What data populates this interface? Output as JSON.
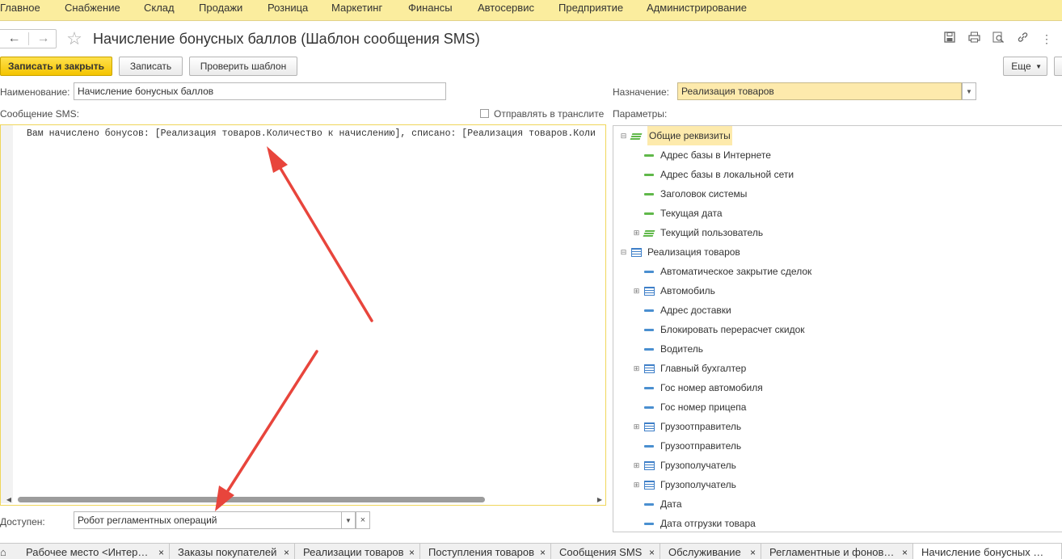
{
  "menu": [
    "Главное",
    "Снабжение",
    "Склад",
    "Продажи",
    "Розница",
    "Маркетинг",
    "Финансы",
    "Автосервис",
    "Предприятие",
    "Администрирование"
  ],
  "window": {
    "title": "Начисление бонусных баллов (Шаблон сообщения SMS)"
  },
  "toolbar": {
    "save_close": "Записать и закрыть",
    "save": "Записать",
    "check": "Проверить шаблон",
    "more": "Еще"
  },
  "form": {
    "name_label": "Наименование:",
    "name_value": "Начисление бонусных баллов",
    "purpose_label": "Назначение:",
    "purpose_value": "Реализация товаров",
    "sms_label": "Сообщение SMS:",
    "translit_label": "Отправлять в транслите",
    "params_label": "Параметры:",
    "sms_text": "Вам начислено бонусов: [Реализация товаров.Количество к начислению], списано: [Реализация товаров.Коли",
    "available_label": "Доступен:",
    "available_value": "Робот регламентных операций"
  },
  "tree": [
    {
      "label": "Общие реквизиты",
      "level": 0,
      "icon": "stack-green",
      "expander": "minus",
      "selected": true
    },
    {
      "label": "Адрес базы в Интернете",
      "level": 1,
      "icon": "dash-green",
      "expander": ""
    },
    {
      "label": "Адрес базы в локальной сети",
      "level": 1,
      "icon": "dash-green",
      "expander": ""
    },
    {
      "label": "Заголовок системы",
      "level": 1,
      "icon": "dash-green",
      "expander": ""
    },
    {
      "label": "Текущая дата",
      "level": 1,
      "icon": "dash-green",
      "expander": ""
    },
    {
      "label": "Текущий пользователь",
      "level": 1,
      "icon": "stack-green",
      "expander": "plus"
    },
    {
      "label": "Реализация товаров",
      "level": 0,
      "icon": "table-blue",
      "expander": "minus"
    },
    {
      "label": "Автоматическое закрытие сделок",
      "level": 1,
      "icon": "dash-blue",
      "expander": ""
    },
    {
      "label": "Автомобиль",
      "level": 1,
      "icon": "table-blue",
      "expander": "plus"
    },
    {
      "label": "Адрес доставки",
      "level": 1,
      "icon": "dash-blue",
      "expander": ""
    },
    {
      "label": "Блокировать перерасчет скидок",
      "level": 1,
      "icon": "dash-blue",
      "expander": ""
    },
    {
      "label": "Водитель",
      "level": 1,
      "icon": "dash-blue",
      "expander": ""
    },
    {
      "label": "Главный бухгалтер",
      "level": 1,
      "icon": "table-blue",
      "expander": "plus"
    },
    {
      "label": "Гос номер автомобиля",
      "level": 1,
      "icon": "dash-blue",
      "expander": ""
    },
    {
      "label": "Гос номер прицепа",
      "level": 1,
      "icon": "dash-blue",
      "expander": ""
    },
    {
      "label": "Грузоотправитель",
      "level": 1,
      "icon": "table-blue",
      "expander": "plus"
    },
    {
      "label": "Грузоотправитель",
      "level": 1,
      "icon": "dash-blue",
      "expander": ""
    },
    {
      "label": "Грузополучатель",
      "level": 1,
      "icon": "table-blue",
      "expander": "plus"
    },
    {
      "label": "Грузополучатель",
      "level": 1,
      "icon": "table-blue",
      "expander": "plus"
    },
    {
      "label": "Дата",
      "level": 1,
      "icon": "dash-blue",
      "expander": ""
    },
    {
      "label": "Дата отгрузки товара",
      "level": 1,
      "icon": "dash-blue",
      "expander": ""
    }
  ],
  "tabs": [
    {
      "label": "Рабочее место <Интер…",
      "active": false
    },
    {
      "label": "Заказы покупателей",
      "active": false
    },
    {
      "label": "Реализации товаров",
      "active": false
    },
    {
      "label": "Поступления товаров",
      "active": false
    },
    {
      "label": "Сообщения SMS",
      "active": false
    },
    {
      "label": "Обслуживание",
      "active": false
    },
    {
      "label": "Регламентные и фонов…",
      "active": false
    },
    {
      "label": "Начисление бонусных …",
      "active": true
    }
  ],
  "colors": {
    "menu_bg": "#fbed9e",
    "primary_button": "#f4c400",
    "selected_field": "#fdeaac",
    "annotation_arrow": "#e8453c"
  }
}
